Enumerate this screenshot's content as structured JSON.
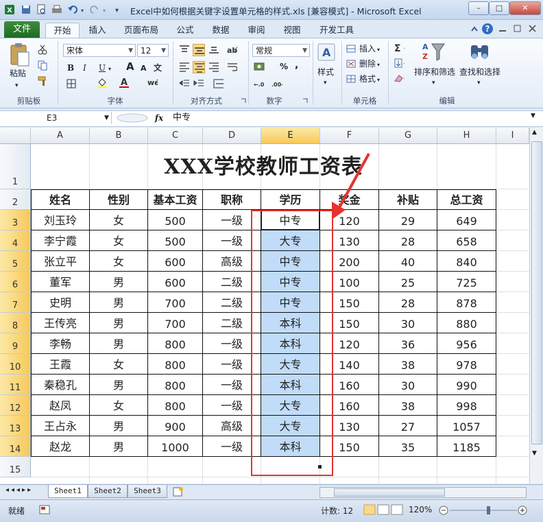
{
  "window": {
    "title": "Excel中如何根据关键字设置单元格的样式.xls  [兼容模式] - Microsoft Excel",
    "min_label": "–",
    "max_label": "□",
    "close_label": "✕"
  },
  "tabs": [
    {
      "label": "文件"
    },
    {
      "label": "开始"
    },
    {
      "label": "插入"
    },
    {
      "label": "页面布局"
    },
    {
      "label": "公式"
    },
    {
      "label": "数据"
    },
    {
      "label": "审阅"
    },
    {
      "label": "视图"
    },
    {
      "label": "开发工具"
    }
  ],
  "ribbon": {
    "clipboard": {
      "paste": "粘贴",
      "label": "剪贴板"
    },
    "font": {
      "name": "宋体",
      "size": "12",
      "bold": "B",
      "italic": "I",
      "underline": "U",
      "grow": "A",
      "shrink": "A",
      "label": "字体"
    },
    "alignment": {
      "label": "对齐方式"
    },
    "number": {
      "format": "常规",
      "percent": "%",
      "comma": ",",
      "label": "数字"
    },
    "styles": {
      "styles": "样式"
    },
    "cells": {
      "insert": "插入",
      "delete": "删除",
      "format": "格式",
      "label": "单元格"
    },
    "editing": {
      "sort": "排序和筛选",
      "find": "查找和选择",
      "label": "编辑"
    }
  },
  "formula_bar": {
    "name_box": "E3",
    "fx": "fx",
    "content": "中专"
  },
  "columns": [
    "A",
    "B",
    "C",
    "D",
    "E",
    "F",
    "G",
    "H",
    "I"
  ],
  "rows": [
    "1",
    "2",
    "3",
    "4",
    "5",
    "6",
    "7",
    "8",
    "9",
    "10",
    "11",
    "12",
    "13",
    "14",
    "15"
  ],
  "sheet": {
    "title": "XXX学校教师工资表",
    "headers": [
      "姓名",
      "性别",
      "基本工资",
      "职称",
      "学历",
      "奖金",
      "补贴",
      "总工资"
    ],
    "data": [
      [
        "刘玉玲",
        "女",
        "500",
        "一级",
        "中专",
        "120",
        "29",
        "649"
      ],
      [
        "李宁霞",
        "女",
        "500",
        "一级",
        "大专",
        "130",
        "28",
        "658"
      ],
      [
        "张立平",
        "女",
        "600",
        "高级",
        "中专",
        "200",
        "40",
        "840"
      ],
      [
        "董军",
        "男",
        "600",
        "二级",
        "中专",
        "100",
        "25",
        "725"
      ],
      [
        "史明",
        "男",
        "700",
        "二级",
        "中专",
        "150",
        "28",
        "878"
      ],
      [
        "王传亮",
        "男",
        "700",
        "二级",
        "本科",
        "150",
        "30",
        "880"
      ],
      [
        "李畅",
        "男",
        "800",
        "一级",
        "本科",
        "120",
        "36",
        "956"
      ],
      [
        "王霞",
        "女",
        "800",
        "一级",
        "大专",
        "140",
        "38",
        "978"
      ],
      [
        "秦稳孔",
        "男",
        "800",
        "一级",
        "本科",
        "160",
        "30",
        "990"
      ],
      [
        "赵凤",
        "女",
        "800",
        "一级",
        "大专",
        "160",
        "38",
        "998"
      ],
      [
        "王占永",
        "男",
        "900",
        "高级",
        "大专",
        "130",
        "27",
        "1057"
      ],
      [
        "赵龙",
        "男",
        "1000",
        "一级",
        "本科",
        "150",
        "35",
        "1185"
      ]
    ]
  },
  "sheet_tabs": [
    "Sheet1",
    "Sheet2",
    "Sheet3"
  ],
  "status": {
    "ready": "就绪",
    "count": "计数: 12",
    "zoom": "120%"
  },
  "colors": {
    "selection": "#c0dcf8",
    "highlight": "#e8322f",
    "header_selected": "#f7c85a"
  }
}
